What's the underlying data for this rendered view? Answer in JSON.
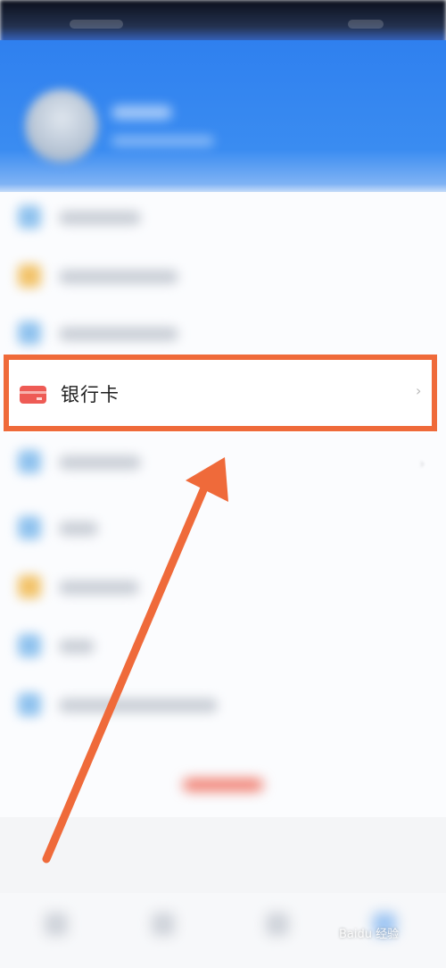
{
  "bank_card": {
    "label": "银行卡",
    "chevron": "›"
  },
  "blurred_row_chevron": "›",
  "watermark": {
    "text": "Baidu 经验"
  },
  "colors": {
    "header_blue": "#2f80ef",
    "highlight_orange": "#ef6a3a",
    "card_red": "#ee5b55"
  },
  "icons": [
    "card-icon",
    "chevron-right-icon",
    "arrow-annotation"
  ]
}
